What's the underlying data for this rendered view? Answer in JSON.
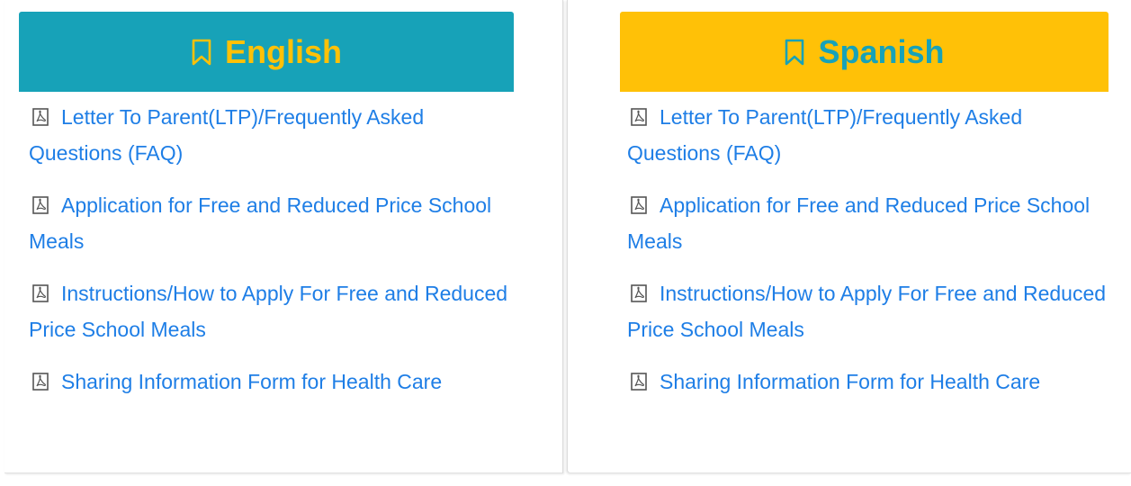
{
  "panels": [
    {
      "title": "English",
      "accent_bg": "#17a2b8",
      "accent_text": "#ffc107",
      "icon": "bookmark-icon",
      "documents": [
        {
          "label": "Letter To Parent(LTP)/Frequently Asked Questions (FAQ)",
          "icon": "pdf-icon"
        },
        {
          "label": "Application for Free and Reduced Price School Meals",
          "icon": "pdf-icon"
        },
        {
          "label": "Instructions/How to Apply For Free and Reduced Price School Meals",
          "icon": "pdf-icon"
        },
        {
          "label": "Sharing Information Form for Health Care",
          "icon": "pdf-icon"
        }
      ]
    },
    {
      "title": "Spanish",
      "accent_bg": "#ffc107",
      "accent_text": "#17a2b8",
      "icon": "bookmark-icon",
      "documents": [
        {
          "label": "Letter To Parent(LTP)/Frequently Asked Questions (FAQ)",
          "icon": "pdf-icon"
        },
        {
          "label": "Application for Free and Reduced Price School Meals",
          "icon": "pdf-icon"
        },
        {
          "label": "Instructions/How to Apply For Free and Reduced Price School Meals",
          "icon": "pdf-icon"
        },
        {
          "label": "Sharing Information Form for Health Care",
          "icon": "pdf-icon"
        }
      ]
    }
  ],
  "link_color": "#1e7ee6"
}
